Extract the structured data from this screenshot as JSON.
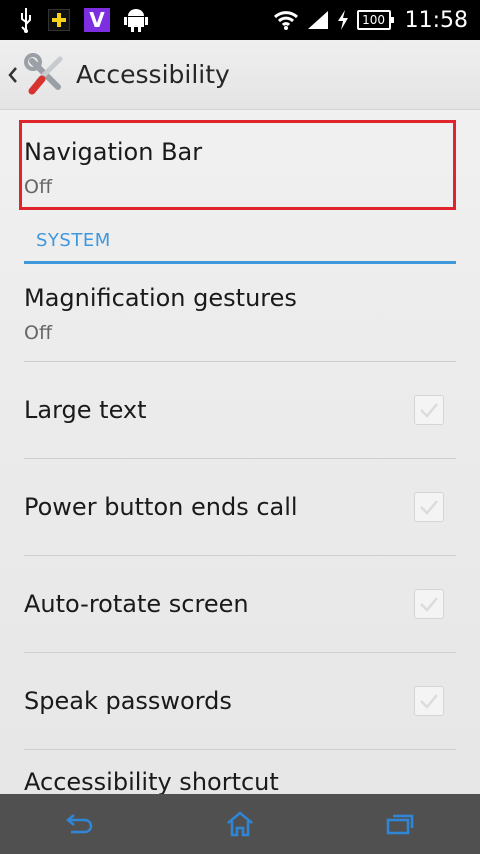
{
  "status_bar": {
    "battery": "100",
    "time": "11:58"
  },
  "action_bar": {
    "title": "Accessibility"
  },
  "highlighted_item": {
    "title": "Navigation Bar",
    "summary": "Off"
  },
  "section": {
    "label": "SYSTEM"
  },
  "items": [
    {
      "title": "Magnification gestures",
      "summary": "Off"
    },
    {
      "title": "Large text",
      "checked": true
    },
    {
      "title": "Power button ends call",
      "checked": true
    },
    {
      "title": "Auto-rotate screen",
      "checked": true
    },
    {
      "title": "Speak passwords",
      "checked": true
    },
    {
      "title": "Accessibility shortcut"
    }
  ],
  "nav_bar": {
    "icons": [
      "back-icon",
      "home-icon",
      "recents-icon"
    ]
  },
  "colors": {
    "accent": "#3f97dc",
    "highlight": "#e0242b",
    "nav_bar": "#505050"
  }
}
